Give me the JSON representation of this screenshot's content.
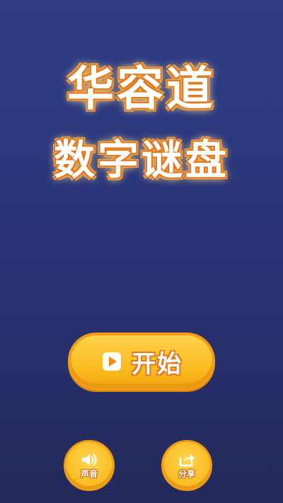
{
  "game": {
    "title_line1": "华容道",
    "title_line2": "数字谜盘"
  },
  "buttons": {
    "start_label": "开始",
    "sound_label": "声音",
    "share_label": "分享"
  },
  "icons": {
    "start": "play-icon",
    "sound": "speaker-icon",
    "share": "share-icon"
  },
  "colors": {
    "background_top": "#2f3d86",
    "background_bottom": "#222a5a",
    "button_fill": "#fbb81e",
    "button_border": "#f39a16",
    "title_outline": "#e27a22"
  }
}
